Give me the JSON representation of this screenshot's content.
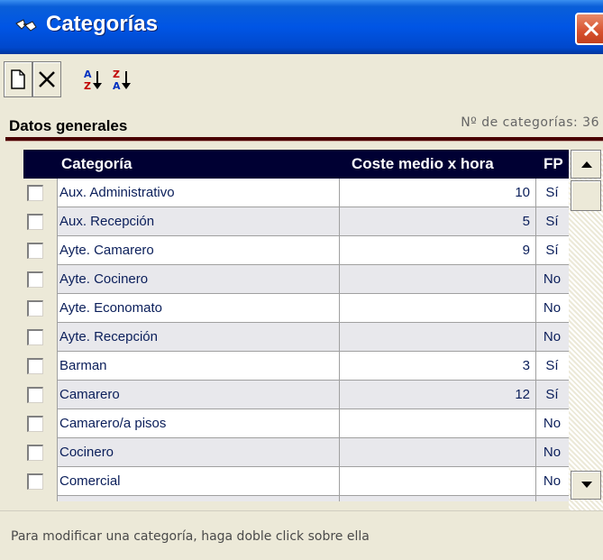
{
  "window": {
    "title": "Categorías",
    "icon": "glasses-icon"
  },
  "toolbar": {
    "buttons": [
      {
        "name": "new-button",
        "icon": "new-document-icon"
      },
      {
        "name": "delete-button",
        "icon": "close-x-icon"
      },
      {
        "name": "sort-asc-button",
        "icon": "sort-az-icon"
      },
      {
        "name": "sort-desc-button",
        "icon": "sort-za-icon"
      }
    ]
  },
  "section": {
    "title": "Datos generales",
    "count_text": "Nº de categorías: 36"
  },
  "grid": {
    "columns": [
      "Categoría",
      "Coste medio x hora",
      "FP"
    ],
    "rows": [
      {
        "name": "Aux. Administrativo",
        "cost": "10",
        "fp": "Sí"
      },
      {
        "name": "Aux. Recepción",
        "cost": "5",
        "fp": "Sí"
      },
      {
        "name": "Ayte. Camarero",
        "cost": "9",
        "fp": "Sí"
      },
      {
        "name": "Ayte. Cocinero",
        "cost": "",
        "fp": "No"
      },
      {
        "name": "Ayte. Economato",
        "cost": "",
        "fp": "No"
      },
      {
        "name": "Ayte. Recepción",
        "cost": "",
        "fp": "No"
      },
      {
        "name": "Barman",
        "cost": "3",
        "fp": "Sí"
      },
      {
        "name": "Camarero",
        "cost": "12",
        "fp": "Sí"
      },
      {
        "name": "Camarero/a pisos",
        "cost": "",
        "fp": "No"
      },
      {
        "name": "Cocinero",
        "cost": "",
        "fp": "No"
      },
      {
        "name": "Comercial",
        "cost": "",
        "fp": "No"
      },
      {
        "name": "",
        "cost": "",
        "fp": ""
      }
    ]
  },
  "status": {
    "text": "Para modificar una categoría, haga doble click sobre ella"
  },
  "colors": {
    "title_bar": "#0055e5",
    "grid_header": "#000033",
    "rule": "#4a0000",
    "close": "#d7512e"
  }
}
